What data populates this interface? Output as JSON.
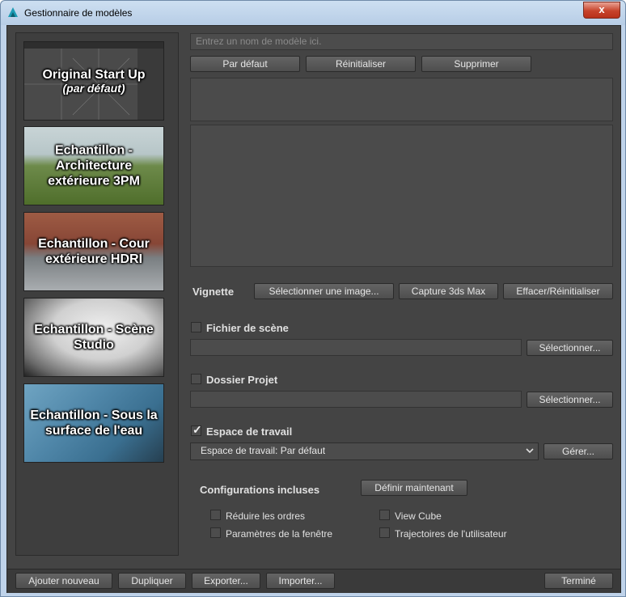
{
  "window": {
    "title": "Gestionnaire de modèles",
    "close_glyph": "x"
  },
  "templates": [
    {
      "name": "Original Start Up",
      "sub": "(par défaut)"
    },
    {
      "name": "Echantillon - Architecture extérieure 3PM"
    },
    {
      "name": "Echantillon - Cour extérieure HDRI"
    },
    {
      "name": "Echantillon - Scène Studio"
    },
    {
      "name": "Echantillon - Sous la surface de l'eau"
    }
  ],
  "name_input": {
    "placeholder": "Entrez un nom de modèle ici."
  },
  "top_buttons": {
    "default": "Par défaut",
    "reset": "Réinitialiser",
    "delete": "Supprimer"
  },
  "thumbnail": {
    "label": "Vignette",
    "select_image": "Sélectionner une image...",
    "capture": "Capture 3ds Max",
    "clear": "Effacer/Réinitialiser"
  },
  "scene_file": {
    "label": "Fichier de scène",
    "checked": false,
    "select": "Sélectionner..."
  },
  "project_folder": {
    "label": "Dossier Projet",
    "checked": false,
    "select": "Sélectionner..."
  },
  "workspace": {
    "label": "Espace de travail",
    "checked": true,
    "value": "Espace de travail: Par défaut",
    "manage": "Gérer..."
  },
  "configs": {
    "label": "Configurations incluses",
    "define_now": "Définir maintenant",
    "items": [
      "Réduire les ordres",
      "View Cube",
      "Paramètres de la fenêtre",
      "Trajectoires de l'utilisateur"
    ]
  },
  "bottom": {
    "add_new": "Ajouter nouveau",
    "duplicate": "Dupliquer",
    "export": "Exporter...",
    "import": "Importer...",
    "done": "Terminé"
  }
}
